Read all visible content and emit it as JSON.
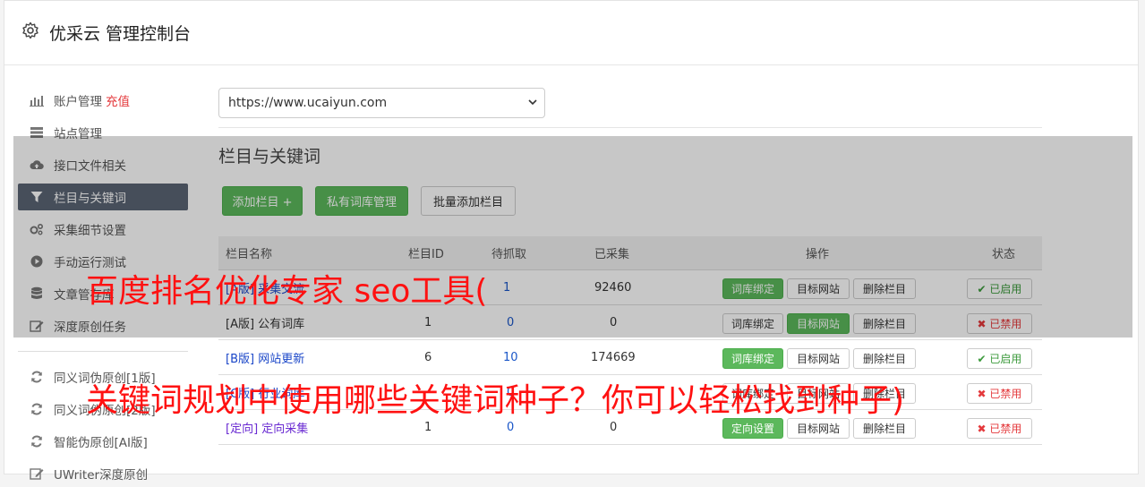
{
  "header": {
    "title": "优采云 管理控制台",
    "icon": "gear-icon"
  },
  "sidebar": {
    "items": [
      {
        "label": "账户管理",
        "extra": "充值",
        "icon": "bar-chart-icon"
      },
      {
        "label": "站点管理",
        "icon": "server-icon"
      },
      {
        "label": "接口文件相关",
        "icon": "cloud-upload-icon"
      },
      {
        "label": "栏目与关键词",
        "icon": "filter-icon"
      },
      {
        "label": "采集细节设置",
        "icon": "cogs-icon"
      },
      {
        "label": "手动运行测试",
        "icon": "play-icon"
      },
      {
        "label": "文章管存库",
        "icon": "database-icon"
      },
      {
        "label": "深度原创任务",
        "icon": "edit-icon"
      },
      {
        "label": "同义词伪原创[1版]",
        "icon": "refresh-icon"
      },
      {
        "label": "同义词伪原创[2版]",
        "icon": "refresh-icon"
      },
      {
        "label": "智能伪原创[AI版]",
        "icon": "refresh-icon"
      },
      {
        "label": "UWriter深度原创",
        "icon": "edit-icon"
      }
    ]
  },
  "site_select": {
    "value": "https://www.ucaiyun.com"
  },
  "section": {
    "title": "栏目与关键词",
    "add_column": "添加栏目 +",
    "private_lib": "私有词库管理",
    "batch_add": "批量添加栏目"
  },
  "table": {
    "headers": {
      "name": "栏目名称",
      "id": "栏目ID",
      "pending": "待抓取",
      "collected": "已采集",
      "ops": "操作",
      "status": "状态"
    },
    "rows": [
      {
        "name": "[A版] 采集交流",
        "id": "",
        "pending": "1",
        "collected": "92460",
        "op1": "词库绑定",
        "op2": "目标网站",
        "op3": "删除栏目",
        "status": "已启用"
      },
      {
        "name": "[A版] 公有词库",
        "id": "1",
        "pending": "0",
        "collected": "0",
        "op1": "词库绑定",
        "op2": "目标网站",
        "op3": "删除栏目",
        "status": "已禁用"
      },
      {
        "name": "[B版] 网站更新",
        "id": "6",
        "pending": "10",
        "collected": "174669",
        "op1": "词库绑定",
        "op2": "目标网站",
        "op3": "删除栏目",
        "status": "已启用"
      },
      {
        "name": "[C版] 行业词库",
        "id": "",
        "pending": "0",
        "collected": "",
        "op1": "词库绑定",
        "op2": "目标网站",
        "op3": "删除栏目",
        "status": "已禁用"
      },
      {
        "name": "[定向] 定向采集",
        "id": "1",
        "pending": "0",
        "collected": "0",
        "op1": "定向设置",
        "op2": "目标网站",
        "op3": "删除栏目",
        "status": "已禁用"
      }
    ]
  },
  "watermark": {
    "line1": "百度排名优化专家 seo工具(",
    "line2": "关键词规划中使用哪些关键词种子？你可以轻松找到种子)"
  },
  "colors": {
    "green": "#5cb85c",
    "red": "#e4393c",
    "active_nav": "#5a6474",
    "link": "#1a46c8"
  }
}
